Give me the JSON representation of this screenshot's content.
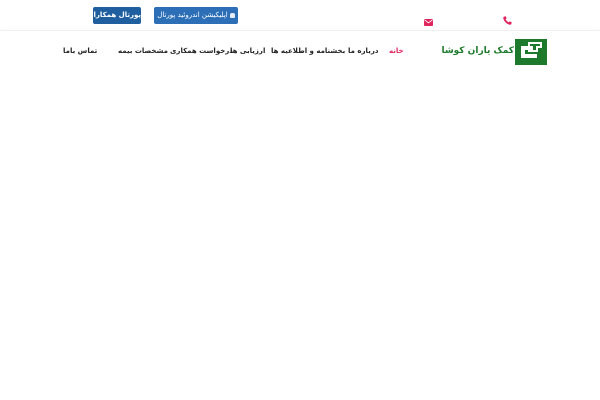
{
  "topbar": {
    "portal_button": "پورتال همکاران",
    "app_button": "اپلیکیشن اندروئید پورتال",
    "icons": {
      "mail": "envelope-icon",
      "phone": "phone-icon",
      "android": "android-icon"
    },
    "colors": {
      "button_dark": "#1f5fa0",
      "button": "#2d6fb7",
      "accent": "#e0245e"
    }
  },
  "nav": {
    "items": [
      {
        "label": "خانه",
        "active": true
      },
      {
        "label": "درباره ما",
        "active": false
      },
      {
        "label": "بخشنامه و اطلاعیه ها",
        "active": false
      },
      {
        "label": "ارزیابی ها",
        "active": false
      },
      {
        "label": "درخواست همکاری",
        "active": false
      },
      {
        "label": "مشخصات بیمه",
        "active": false
      },
      {
        "label": "تماس باما",
        "active": false
      }
    ]
  },
  "logo": {
    "text": "کمک یاران کوشا",
    "color": "#1d7a2c"
  }
}
